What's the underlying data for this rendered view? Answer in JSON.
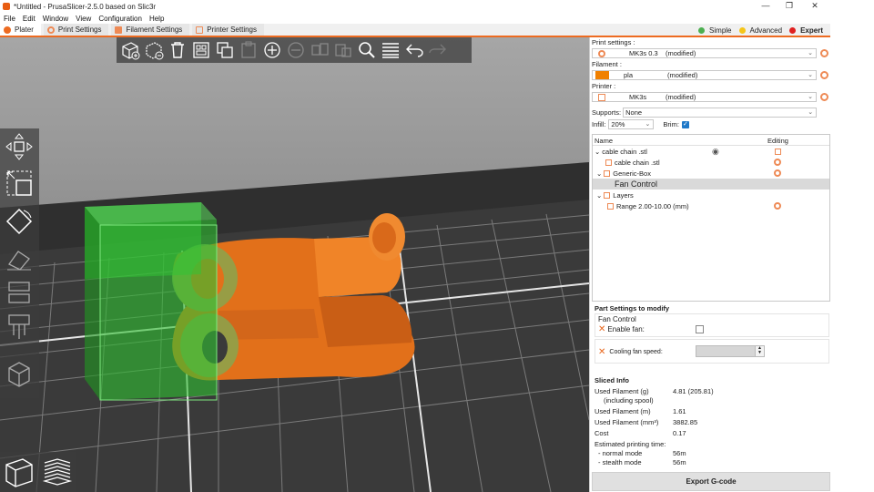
{
  "window": {
    "title": "*Untitled - PrusaSlicer-2.5.0 based on Slic3r",
    "minimize": "—",
    "maximize": "❐",
    "close": "✕"
  },
  "menu": [
    "File",
    "Edit",
    "Window",
    "View",
    "Configuration",
    "Help"
  ],
  "tabs": [
    {
      "label": "Plater",
      "active": true
    },
    {
      "label": "Print Settings",
      "active": false
    },
    {
      "label": "Filament Settings",
      "active": false
    },
    {
      "label": "Printer Settings",
      "active": false
    }
  ],
  "modes": [
    {
      "label": "Simple",
      "color": "#4caf50"
    },
    {
      "label": "Advanced",
      "color": "#f5c518"
    },
    {
      "label": "Expert",
      "color": "#e02020"
    }
  ],
  "sidebar": {
    "print_settings_label": "Print settings :",
    "print_preset": {
      "name": "MK3s 0.3",
      "modified": "(modified)"
    },
    "filament_label": "Filament :",
    "filament_preset": {
      "name": "pla",
      "modified": "(modified)",
      "color": "#f08000"
    },
    "printer_label": "Printer :",
    "printer_preset": {
      "name": "MK3s",
      "modified": "(modified)"
    },
    "supports_label": "Supports:",
    "supports_value": "None",
    "infill_label": "Infill:",
    "infill_value": "20%",
    "brim_label": "Brim:",
    "brim_check": "✓"
  },
  "object_list": {
    "col_name": "Name",
    "col_editing": "Editing",
    "rows": [
      {
        "label": "cable chain       .stl",
        "indent": 0
      },
      {
        "label": "cable chain       .stl",
        "indent": 1
      },
      {
        "label": "Generic-Box",
        "indent": 1
      },
      {
        "label": "Fan Control",
        "indent": 2,
        "selected": true
      },
      {
        "label": "Layers",
        "indent": 1
      },
      {
        "label": "Range 2.00-10.00 (mm)",
        "indent": 2
      }
    ]
  },
  "part_settings": {
    "title": "Part Settings to modify",
    "group": "Fan Control",
    "enable_fan_label": "Enable fan:",
    "cooling_fan_label": "Cooling fan speed:",
    "spinner_up": "▲",
    "spinner_down": "▼"
  },
  "sliced_info": {
    "title": "Sliced Info",
    "rows": [
      {
        "k": "Used Filament (g)",
        "v": "4.81 (205.81)"
      },
      {
        "k": "    (including spool)",
        "v": ""
      },
      {
        "k": "Used Filament (m)",
        "v": "1.61"
      },
      {
        "k": "Used Filament (mm³)",
        "v": "3882.85"
      },
      {
        "k": "Cost",
        "v": "0.17"
      },
      {
        "k": "Estimated printing time:",
        "v": ""
      },
      {
        "k": "  - normal mode",
        "v": "56m"
      },
      {
        "k": "  - stealth mode",
        "v": "56m"
      }
    ]
  },
  "export_label": "Export G-code"
}
